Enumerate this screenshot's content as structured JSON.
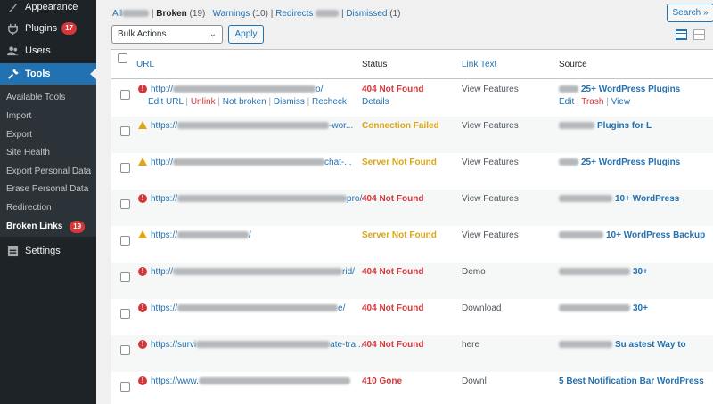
{
  "sidebar": {
    "items": [
      {
        "label": "Appearance",
        "icon": "paintbrush-icon"
      },
      {
        "label": "Plugins",
        "icon": "plugin-icon",
        "badge": "17"
      },
      {
        "label": "Users",
        "icon": "users-icon"
      },
      {
        "label": "Tools",
        "icon": "wrench-icon"
      },
      {
        "label": "Settings",
        "icon": "settings-icon"
      }
    ],
    "submenu": [
      {
        "label": "Available Tools"
      },
      {
        "label": "Import"
      },
      {
        "label": "Export"
      },
      {
        "label": "Site Health"
      },
      {
        "label": "Export Personal Data"
      },
      {
        "label": "Erase Personal Data"
      },
      {
        "label": "Redirection"
      },
      {
        "label": "Broken Links",
        "badge": "19"
      }
    ]
  },
  "filters": {
    "all": "All",
    "broken": "Broken",
    "broken_count": "(19)",
    "sep": "|",
    "warnings": "Warnings",
    "warnings_count": "(10)",
    "redirects": "Redirects",
    "dismissed": "Dismissed",
    "dismissed_count": "(1)"
  },
  "toolbar": {
    "search_label": "Search »",
    "bulk_actions": "Bulk Actions",
    "apply_label": "Apply"
  },
  "table": {
    "headers": {
      "url": "URL",
      "status": "Status",
      "link_text": "Link Text",
      "source": "Source"
    },
    "row_actions": {
      "edit_url": "Edit URL",
      "unlink": "Unlink",
      "not_broken": "Not broken",
      "dismiss": "Dismiss",
      "recheck": "Recheck",
      "details": "Details"
    },
    "source_actions": {
      "edit": "Edit",
      "trash": "Trash",
      "view": "View"
    },
    "rows": [
      {
        "icon": "error",
        "url_start": "http://",
        "url_end": "o/",
        "status": "404 Not Found",
        "status_color": "red",
        "link_text": "View Features",
        "source": "25+ WordPress Plugins"
      },
      {
        "icon": "warning",
        "url_start": "https://",
        "url_end": "-wor...",
        "status": "Connection Failed",
        "status_color": "orange",
        "link_text": "View Features",
        "source": "Plugins for L"
      },
      {
        "icon": "warning",
        "url_start": "http://",
        "url_end": "chat-...",
        "status": "Server Not Found",
        "status_color": "orange",
        "link_text": "View Features",
        "source": "25+ WordPress Plugins"
      },
      {
        "icon": "error",
        "url_start": "https://",
        "url_end": "pro/",
        "status": "404 Not Found",
        "status_color": "red",
        "link_text": "View Features",
        "source": "10+ WordPress"
      },
      {
        "icon": "warning",
        "url_start": "https://",
        "url_end": "/",
        "status": "Server Not Found",
        "status_color": "orange",
        "link_text": "View Features",
        "source": "10+ WordPress Backup"
      },
      {
        "icon": "error",
        "url_start": "http://",
        "url_end": "rid/",
        "status": "404 Not Found",
        "status_color": "red",
        "link_text": "Demo",
        "source": "30+"
      },
      {
        "icon": "error",
        "url_start": "https://",
        "url_end": "e/",
        "status": "404 Not Found",
        "status_color": "red",
        "link_text": "Download",
        "source": "30+"
      },
      {
        "icon": "error",
        "url_start": "https://survi",
        "url_end": "ate-tra...",
        "status": "404 Not Found",
        "status_color": "red",
        "link_text": "here",
        "source": "Su astest Way to"
      },
      {
        "icon": "error",
        "url_start": "https://www.",
        "url_end": "",
        "status": "410 Gone",
        "status_color": "red",
        "link_text": "Downl",
        "source": "5 Best Notification Bar WordPress"
      }
    ]
  }
}
